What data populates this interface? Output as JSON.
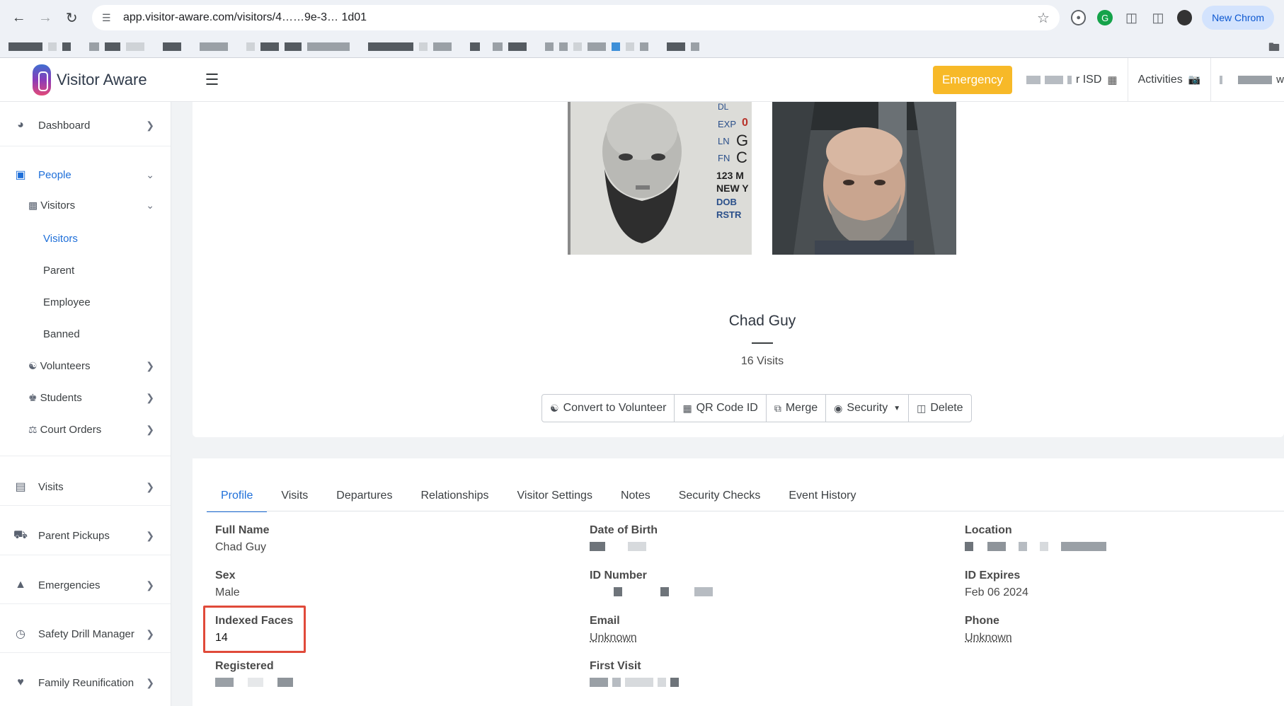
{
  "browser": {
    "url": "app.visitor-aware.com/visitors/4……9e-3… 1d01",
    "new_chrome_label": "New Chrom"
  },
  "header": {
    "app_name": "Visitor Aware",
    "emergency_label": "Emergency",
    "district_label": "r ISD",
    "activities_label": "Activities",
    "emergency_color": "#f7b928"
  },
  "sidebar": {
    "items": [
      {
        "label": "Dashboard",
        "icon": "gauge-icon"
      },
      {
        "label": "People",
        "icon": "id-badge-icon"
      },
      {
        "label": "Visits",
        "icon": "calendar-icon"
      },
      {
        "label": "Parent Pickups",
        "icon": "car-icon"
      },
      {
        "label": "Emergencies",
        "icon": "warning-icon"
      },
      {
        "label": "Safety Drill Manager",
        "icon": "clock-icon"
      },
      {
        "label": "Family Reunification",
        "icon": "hand-heart-icon"
      }
    ],
    "people_sub": [
      {
        "label": "Visitors",
        "icon": "id-card-icon"
      },
      {
        "label": "Volunteers",
        "icon": "handshake-icon"
      },
      {
        "label": "Students",
        "icon": "graduate-icon"
      },
      {
        "label": "Court Orders",
        "icon": "scale-icon"
      }
    ],
    "visitors_leaves": [
      "Visitors",
      "Parent",
      "Employee",
      "Banned"
    ]
  },
  "visitor": {
    "name": "Chad Guy",
    "visits": "16 Visits"
  },
  "actions": {
    "convert": "Convert to Volunteer",
    "qr": "QR Code ID",
    "merge": "Merge",
    "security": "Security",
    "delete": "Delete"
  },
  "tabs": [
    "Profile",
    "Visits",
    "Departures",
    "Relationships",
    "Visitor Settings",
    "Notes",
    "Security Checks",
    "Event History"
  ],
  "profile": {
    "full_name_label": "Full Name",
    "full_name": "Chad Guy",
    "sex_label": "Sex",
    "sex": "Male",
    "indexed_faces_label": "Indexed Faces",
    "indexed_faces": "14",
    "registered_label": "Registered",
    "dob_label": "Date of Birth",
    "id_number_label": "ID Number",
    "email_label": "Email",
    "email": "Unknown",
    "first_visit_label": "First Visit",
    "location_label": "Location",
    "id_expires_label": "ID Expires",
    "id_expires": "Feb 06 2024",
    "phone_label": "Phone",
    "phone": "Unknown"
  },
  "license_snippet": {
    "lines": [
      "DL",
      "EXP",
      "LN",
      "FN",
      "123 M",
      "NEW Y",
      "DOB",
      "RSTR"
    ],
    "values": [
      "0",
      "G",
      "C"
    ]
  }
}
